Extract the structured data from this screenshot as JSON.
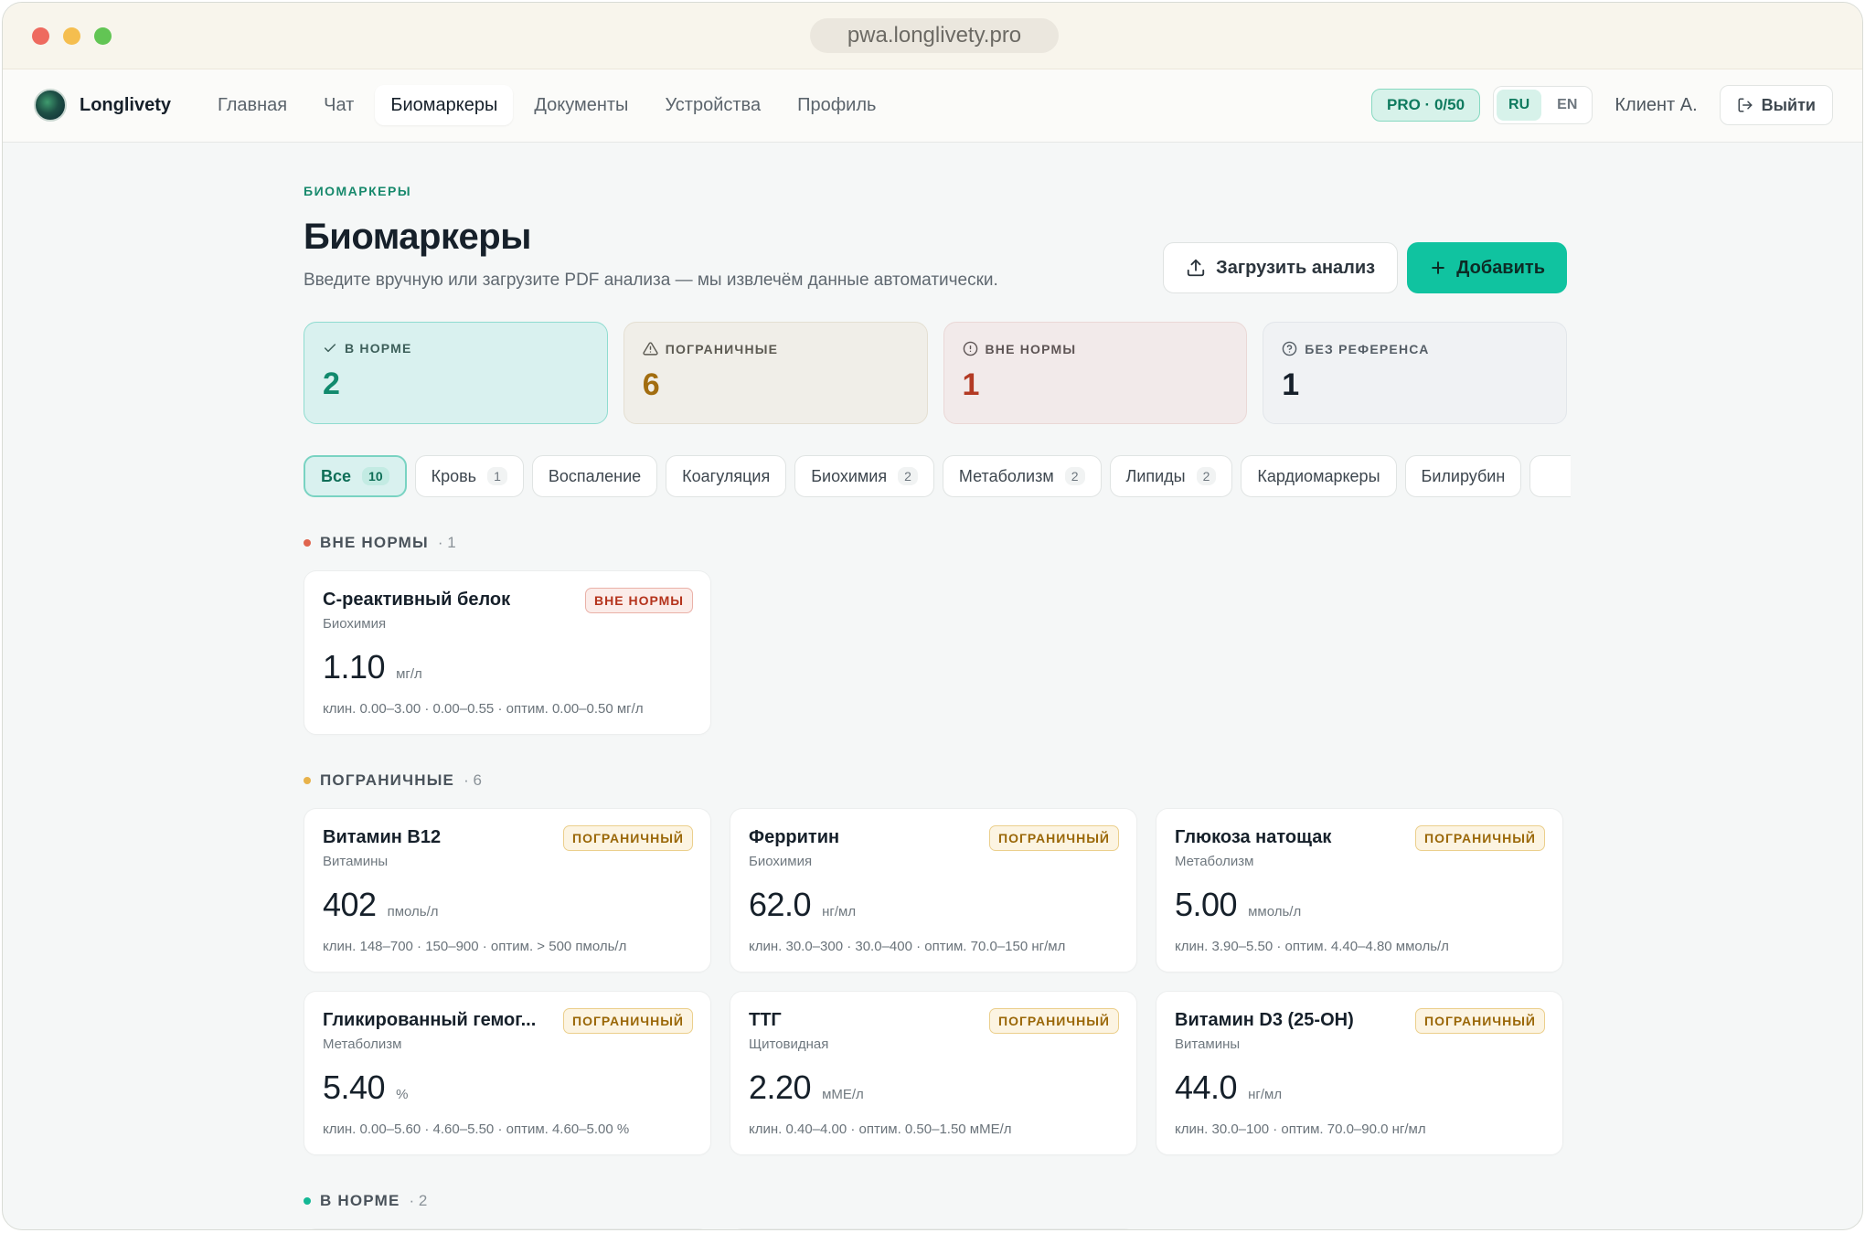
{
  "browser": {
    "url": "pwa.longlivety.pro"
  },
  "nav": {
    "brand": "Longlivety",
    "items": [
      "Главная",
      "Чат",
      "Биомаркеры",
      "Документы",
      "Устройства",
      "Профиль"
    ],
    "active_index": 2,
    "plan_badge": "PRO · 0/50",
    "languages": [
      "RU",
      "EN"
    ],
    "active_language": "RU",
    "user": "Клиент А.",
    "logout": "Выйти"
  },
  "page": {
    "eyebrow": "БИОМАРКЕРЫ",
    "title": "Биомаркеры",
    "subtitle": "Введите вручную или загрузите PDF анализа — мы извлечём данные автоматически.",
    "upload_label": "Загрузить анализ",
    "add_label": "Добавить"
  },
  "stats": {
    "normal": {
      "label": "В НОРМЕ",
      "value": "2"
    },
    "borderline": {
      "label": "ПОГРАНИЧНЫЕ",
      "value": "6"
    },
    "out": {
      "label": "ВНЕ НОРМЫ",
      "value": "1"
    },
    "noref": {
      "label": "БЕЗ РЕФЕРЕНСА",
      "value": "1"
    }
  },
  "filters": [
    {
      "label": "Все",
      "count": "10",
      "active": true
    },
    {
      "label": "Кровь",
      "count": "1"
    },
    {
      "label": "Воспаление",
      "count": ""
    },
    {
      "label": "Коагуляция",
      "count": ""
    },
    {
      "label": "Биохимия",
      "count": "2"
    },
    {
      "label": "Метаболизм",
      "count": "2"
    },
    {
      "label": "Липиды",
      "count": "2"
    },
    {
      "label": "Кардиомаркеры",
      "count": ""
    },
    {
      "label": "Билирубин",
      "count": ""
    },
    {
      "label": "",
      "count": ""
    }
  ],
  "sections": {
    "out": {
      "title": "ВНЕ НОРМЫ",
      "count": "· 1",
      "color": "#e0654e",
      "cards": [
        {
          "name": "С-реактивный белок",
          "category": "Биохимия",
          "badge": "ВНЕ НОРМЫ",
          "value": "1.10",
          "unit": "мг/л",
          "range": "клин. 0.00–3.00 · 0.00–0.55 · оптим. 0.00–0.50 мг/л"
        }
      ]
    },
    "borderline": {
      "title": "ПОГРАНИЧНЫЕ",
      "count": "· 6",
      "color": "#e8b24a",
      "cards": [
        {
          "name": "Витамин B12",
          "category": "Витамины",
          "badge": "ПОГРАНИЧНЫЙ",
          "value": "402",
          "unit": "пмоль/л",
          "range": "клин. 148–700 · 150–900 · оптим. > 500 пмоль/л"
        },
        {
          "name": "Ферритин",
          "category": "Биохимия",
          "badge": "ПОГРАНИЧНЫЙ",
          "value": "62.0",
          "unit": "нг/мл",
          "range": "клин. 30.0–300 · 30.0–400 · оптим. 70.0–150 нг/мл"
        },
        {
          "name": "Глюкоза натощак",
          "category": "Метаболизм",
          "badge": "ПОГРАНИЧНЫЙ",
          "value": "5.00",
          "unit": "ммоль/л",
          "range": "клин. 3.90–5.50 · оптим. 4.40–4.80 ммоль/л"
        },
        {
          "name": "Гликированный гемог...",
          "category": "Метаболизм",
          "badge": "ПОГРАНИЧНЫЙ",
          "value": "5.40",
          "unit": "%",
          "range": "клин. 0.00–5.60 · 4.60–5.50 · оптим. 4.60–5.00 %"
        },
        {
          "name": "ТТГ",
          "category": "Щитовидная",
          "badge": "ПОГРАНИЧНЫЙ",
          "value": "2.20",
          "unit": "мМЕ/л",
          "range": "клин. 0.40–4.00 · оптим. 0.50–1.50 мМЕ/л"
        },
        {
          "name": "Витамин D3 (25-OH)",
          "category": "Витамины",
          "badge": "ПОГРАНИЧНЫЙ",
          "value": "44.0",
          "unit": "нг/мл",
          "range": "клин. 30.0–100 · оптим. 70.0–90.0 нг/мл"
        }
      ]
    },
    "normal": {
      "title": "В НОРМЕ",
      "count": "· 2",
      "color": "#14b895"
    }
  }
}
